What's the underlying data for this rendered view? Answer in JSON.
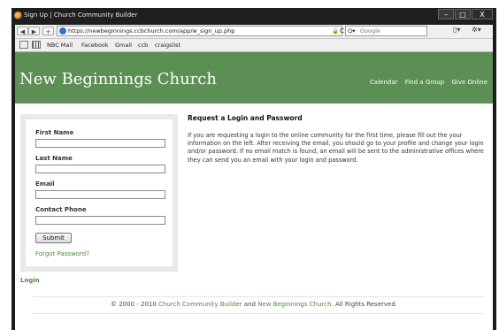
{
  "window": {
    "title": "Sign Up | Church Community Builder",
    "controls": [
      "–",
      "□",
      "X"
    ]
  },
  "nav": {
    "back": "◀",
    "forward": "▶",
    "new_tab": "+",
    "url": "https://newbeginnings.ccbchurch.com/app/w_sign_up.php",
    "lock": "🔒",
    "refresh": "C",
    "search_engine": "Q▾",
    "search_placeholder": "Google",
    "page_menu": "▯▾",
    "tools_menu": "✲▾"
  },
  "bookmarks": [
    "NBC Mail",
    "Facebook",
    "Gmail",
    "ccb",
    "craigslist"
  ],
  "site": {
    "name": "New Beginnings Church",
    "nav": [
      "Calendar",
      "Find a Group",
      "Give Online"
    ]
  },
  "form": {
    "first_name_label": "First Name",
    "last_name_label": "Last Name",
    "email_label": "Email",
    "phone_label": "Contact Phone",
    "first_name_value": "",
    "last_name_value": "",
    "email_value": "",
    "phone_value": "",
    "submit_label": "Submit",
    "forgot_label": "Forgot Password?"
  },
  "login_link": "Login",
  "content": {
    "heading": "Request a Login and Password",
    "body": "If you are requesting a login to the online community for the first time, please fill out the your information on the left. After receiving the email, you should go to your profile and change your login and/or password. If no email match is found, an email will be sent to the administrative offices where they can send you an email with your login and password."
  },
  "footer": {
    "prefix": "© 2000 - 2010",
    "link1": "Church Community Builder",
    "mid": "and",
    "link2": "New Beginnings Church",
    "suffix": ". All Rights Reserved."
  },
  "colors": {
    "header_green": "#5b8f53",
    "link_green": "#4d8a3f"
  }
}
